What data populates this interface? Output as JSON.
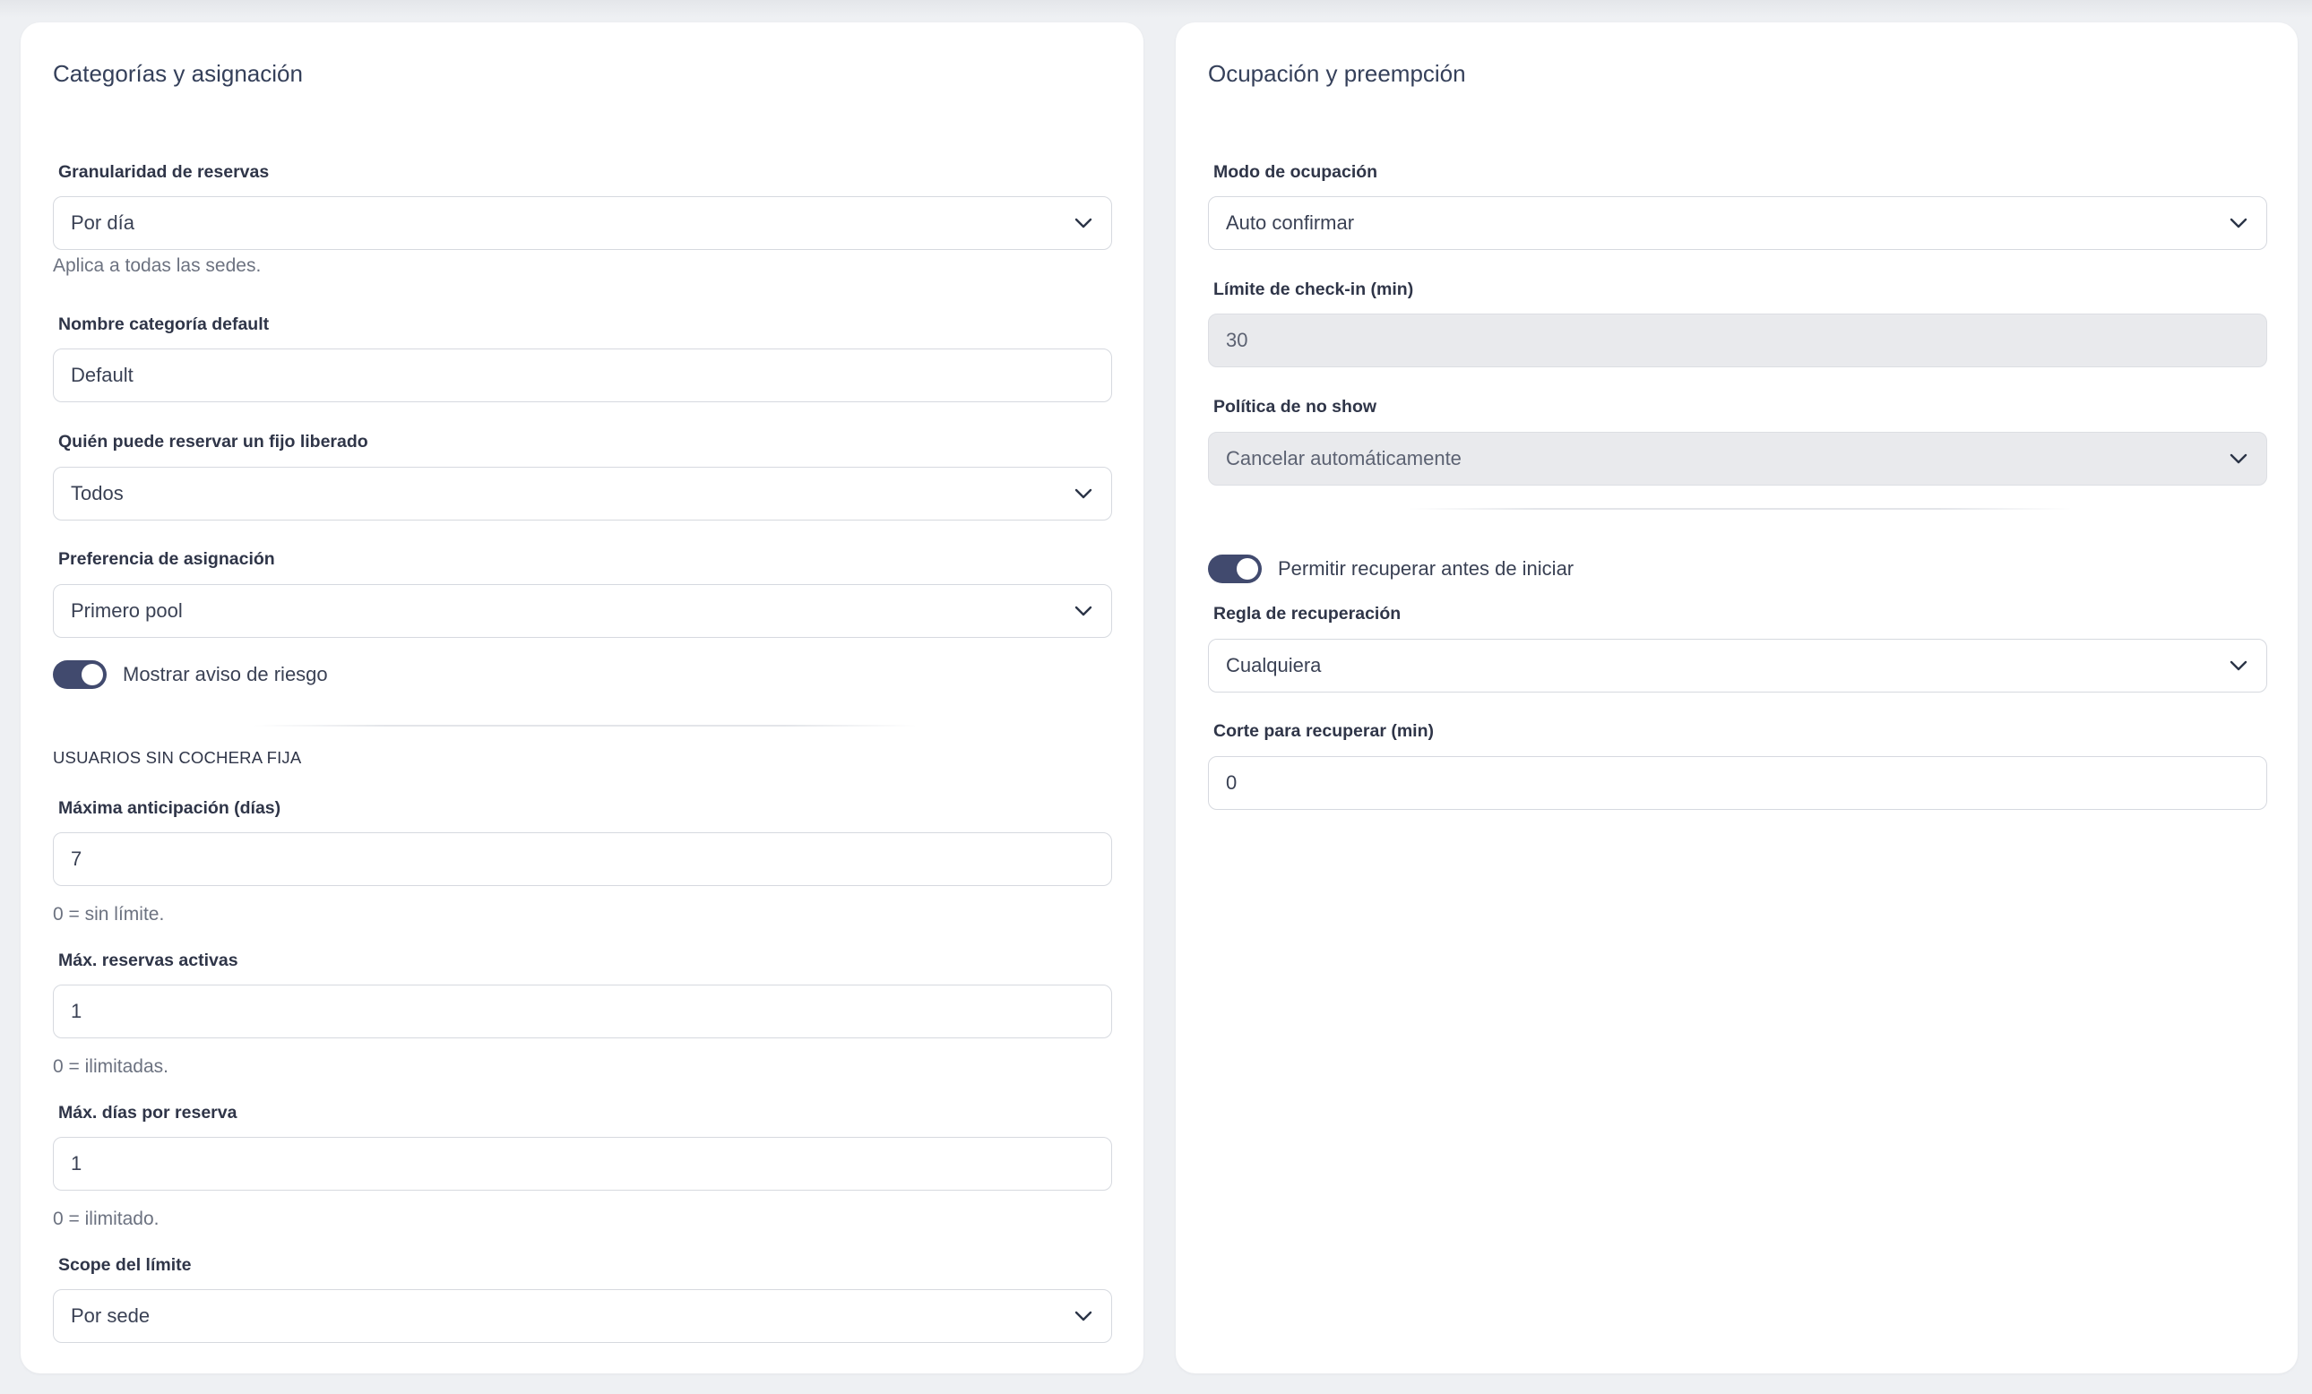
{
  "left_card": {
    "title": "Categorías y asignación",
    "granularity": {
      "label": "Granularidad de reservas",
      "value": "Por día",
      "help": "Aplica a todas las sedes."
    },
    "default_category": {
      "label": "Nombre categoría default",
      "value": "Default"
    },
    "who_can_book": {
      "label": "Quién puede reservar un fijo liberado",
      "value": "Todos"
    },
    "assignment_preference": {
      "label": "Preferencia de asignación",
      "value": "Primero pool"
    },
    "risk_warning_toggle": {
      "label": "Mostrar aviso de riesgo",
      "on": true
    },
    "section_heading": "USUARIOS SIN COCHERA FIJA",
    "max_advance": {
      "label": "Máxima anticipación (días)",
      "value": "7",
      "help": "0 = sin límite."
    },
    "max_active": {
      "label": "Máx. reservas activas",
      "value": "1",
      "help": "0 = ilimitadas."
    },
    "max_days": {
      "label": "Máx. días por reserva",
      "value": "1",
      "help": "0 = ilimitado."
    },
    "limit_scope": {
      "label": "Scope del límite",
      "value": "Por sede"
    }
  },
  "right_card": {
    "title": "Ocupación y preempción",
    "occupation_mode": {
      "label": "Modo de ocupación",
      "value": "Auto confirmar"
    },
    "checkin_limit": {
      "label": "Límite de check-in (min)",
      "value": "30"
    },
    "no_show_policy": {
      "label": "Política de no show",
      "value": "Cancelar automáticamente"
    },
    "recover_toggle": {
      "label": "Permitir recuperar antes de iniciar",
      "on": true
    },
    "recovery_rule": {
      "label": "Regla de recuperación",
      "value": "Cualquiera"
    },
    "recovery_cutoff": {
      "label": "Corte para recuperar (min)",
      "value": "0"
    }
  },
  "colors": {
    "toggle_on": "#414a6e",
    "card_background": "#ffffff",
    "page_background": "#eef0f3",
    "disabled_field": "#e9eaed"
  },
  "icons": {
    "select_arrow": "chevron-down-icon"
  }
}
